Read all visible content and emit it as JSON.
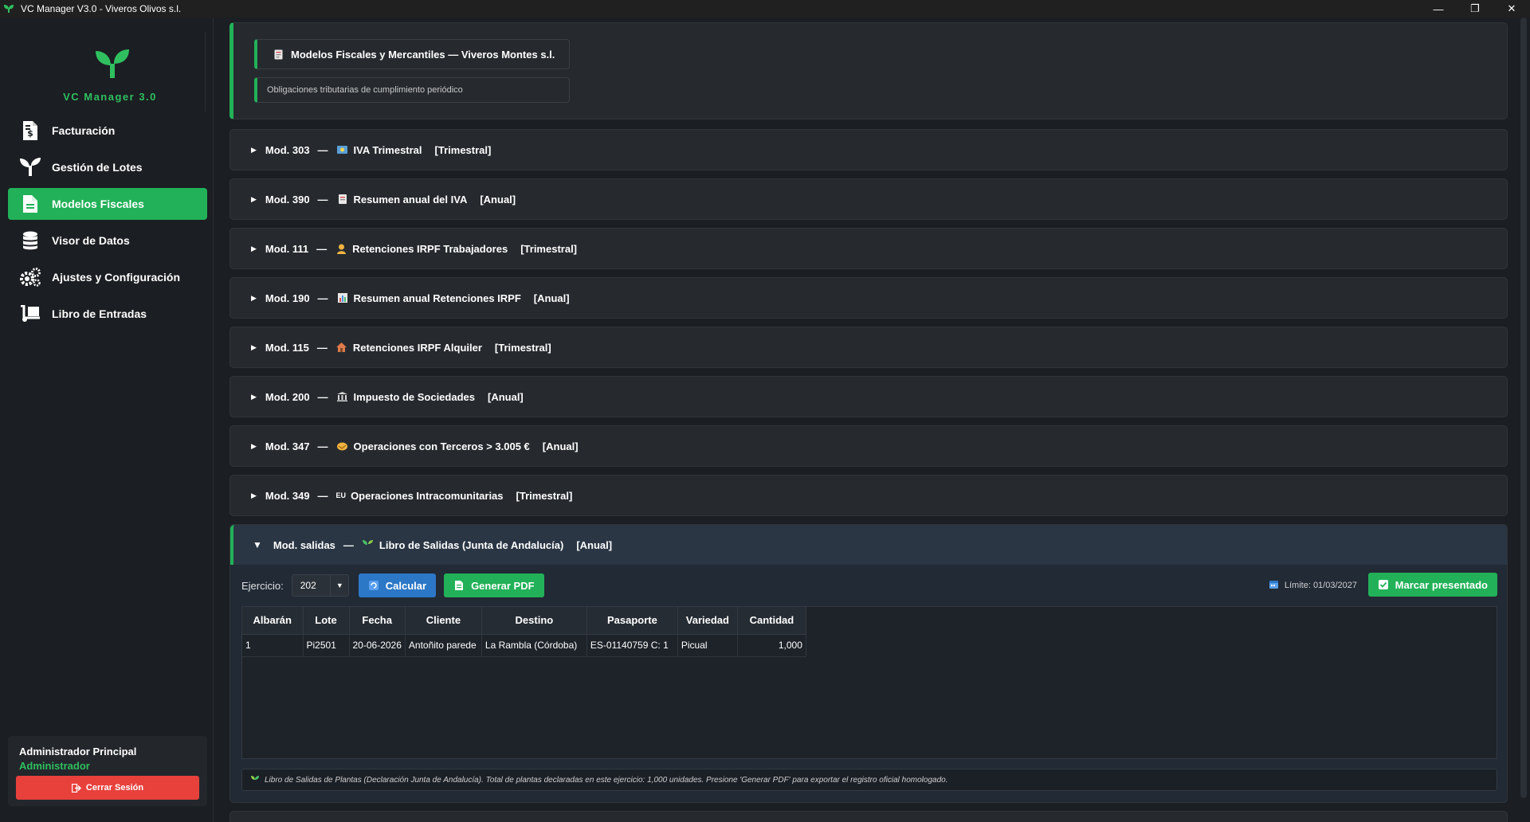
{
  "window": {
    "title": "VC Manager V3.0 - Viveros Olivos s.l.",
    "controls": {
      "minimize": "—",
      "restore": "❐",
      "close": "✕"
    }
  },
  "sidebar": {
    "logo_text": "VC Manager 3.0",
    "items": [
      {
        "label": "Facturación",
        "icon": "invoice-dollar-icon",
        "active": false
      },
      {
        "label": "Gestión de Lotes",
        "icon": "seedling-icon",
        "active": false
      },
      {
        "label": "Modelos Fiscales",
        "icon": "document-icon",
        "active": true
      },
      {
        "label": "Visor de Datos",
        "icon": "database-icon",
        "active": false
      },
      {
        "label": "Ajustes y Configuración",
        "icon": "gears-icon",
        "active": false
      },
      {
        "label": "Libro de Entradas",
        "icon": "dolly-icon",
        "active": false
      }
    ],
    "user": {
      "name": "Administrador Principal",
      "role": "Administrador",
      "logout_label": "Cerrar Sesión"
    }
  },
  "header": {
    "title": "Modelos Fiscales y Mercantiles — Viveros Montes s.l.",
    "subtitle": "Obligaciones tributarias de cumplimiento periódico"
  },
  "models": [
    {
      "code": "Mod. 303",
      "name": "IVA Trimestral",
      "period": "[Trimestral]",
      "icon": "euro-note-icon"
    },
    {
      "code": "Mod. 390",
      "name": "Resumen anual del IVA",
      "period": "[Anual]",
      "icon": "receipt-icon"
    },
    {
      "code": "Mod. 111",
      "name": "Retenciones IRPF Trabajadores",
      "period": "[Trimestral]",
      "icon": "worker-icon"
    },
    {
      "code": "Mod. 190",
      "name": "Resumen anual Retenciones IRPF",
      "period": "[Anual]",
      "icon": "chart-icon"
    },
    {
      "code": "Mod. 115",
      "name": "Retenciones IRPF Alquiler",
      "period": "[Trimestral]",
      "icon": "house-icon"
    },
    {
      "code": "Mod. 200",
      "name": "Impuesto de Sociedades",
      "period": "[Anual]",
      "icon": "bank-icon"
    },
    {
      "code": "Mod. 347",
      "name": "Operaciones con Terceros > 3.005 €",
      "period": "[Anual]",
      "icon": "handshake-icon"
    },
    {
      "code": "Mod. 349",
      "name": "Operaciones Intracomunitarias",
      "period": "[Trimestral]",
      "icon": "eu-icon",
      "icon_text": "EU"
    }
  ],
  "open_model": {
    "code": "Mod. salidas",
    "name": "Libro de Salidas (Junta de Andalucía)",
    "period": "[Anual]",
    "icon": "seedling-icon",
    "exercise_label": "Ejercicio:",
    "exercise_value": "202",
    "calc_label": "Calcular",
    "pdf_label": "Generar PDF",
    "deadline_label": "Límite: 01/03/2027",
    "mark_label": "Marcar presentado",
    "table": {
      "columns": [
        "Albarán",
        "Lote",
        "Fecha",
        "Cliente",
        "Destino",
        "Pasaporte",
        "Variedad",
        "Cantidad"
      ],
      "rows": [
        [
          "1",
          "Pi2501",
          "20-06-2026",
          "Antoñito parede",
          "La Rambla (Córdoba)",
          "ES-01140759 C: 1",
          "Picual",
          "1,000"
        ]
      ]
    },
    "note": "Libro de Salidas de Plantas (Declaración Junta de Andalucía). Total de plantas declaradas en este ejercicio: 1,000 unidades. Presione 'Generar PDF' para exportar el registro oficial homologado."
  },
  "colors": {
    "accent_green": "#22b158",
    "accent_blue": "#2c78c7",
    "danger_red": "#e8413c",
    "background": "#1b1e22"
  }
}
